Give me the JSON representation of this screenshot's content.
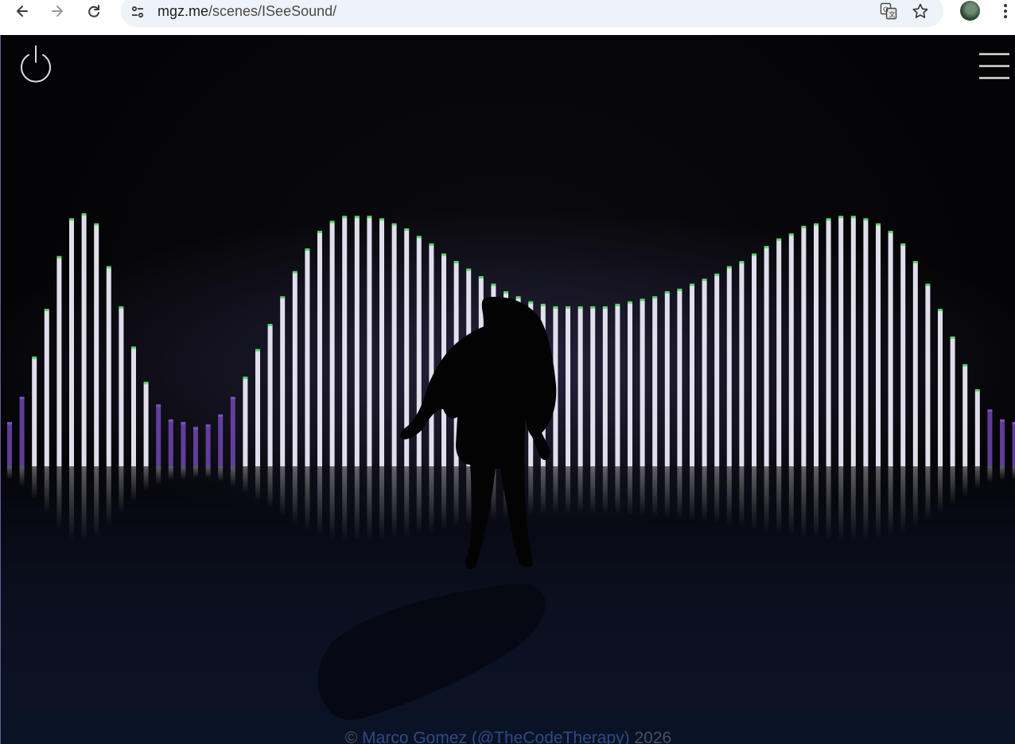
{
  "browser": {
    "url_host": "mgz.me",
    "url_path": "/scenes/ISeeSound/",
    "back_icon": "arrow-left-icon",
    "forward_icon": "arrow-right-icon",
    "reload_icon": "reload-icon",
    "site_info_icon": "tune-icon",
    "translate_icon": "translate-icon",
    "bookmark_icon": "star-icon",
    "menu_icon": "more-vertical-icon"
  },
  "page": {
    "power_icon": "power-icon",
    "menu_icon": "hamburger-menu-icon",
    "footer": {
      "copyright": "©",
      "author_link": "Marco Gomez (@TheCodeTherapy)",
      "year": "2026"
    }
  },
  "visualizer": {
    "bar_levels": [
      0.17,
      0.27,
      0.43,
      0.62,
      0.83,
      0.98,
      1.0,
      0.96,
      0.79,
      0.63,
      0.47,
      0.33,
      0.24,
      0.18,
      0.17,
      0.15,
      0.16,
      0.2,
      0.27,
      0.35,
      0.46,
      0.56,
      0.67,
      0.77,
      0.86,
      0.93,
      0.97,
      0.99,
      0.99,
      0.99,
      0.98,
      0.96,
      0.94,
      0.91,
      0.88,
      0.84,
      0.81,
      0.78,
      0.75,
      0.72,
      0.69,
      0.67,
      0.65,
      0.64,
      0.63,
      0.63,
      0.63,
      0.63,
      0.63,
      0.64,
      0.65,
      0.66,
      0.67,
      0.69,
      0.7,
      0.72,
      0.74,
      0.76,
      0.79,
      0.81,
      0.84,
      0.87,
      0.9,
      0.92,
      0.95,
      0.96,
      0.98,
      0.99,
      0.99,
      0.98,
      0.96,
      0.93,
      0.88,
      0.81,
      0.72,
      0.62,
      0.51,
      0.4,
      0.3,
      0.22,
      0.18,
      0.17
    ],
    "colors": {
      "bar_core": "#f4f1ff",
      "bar_tip": "#5bd86a",
      "bar_fade": "#7e4fc9",
      "floor": "#0b1020"
    }
  }
}
